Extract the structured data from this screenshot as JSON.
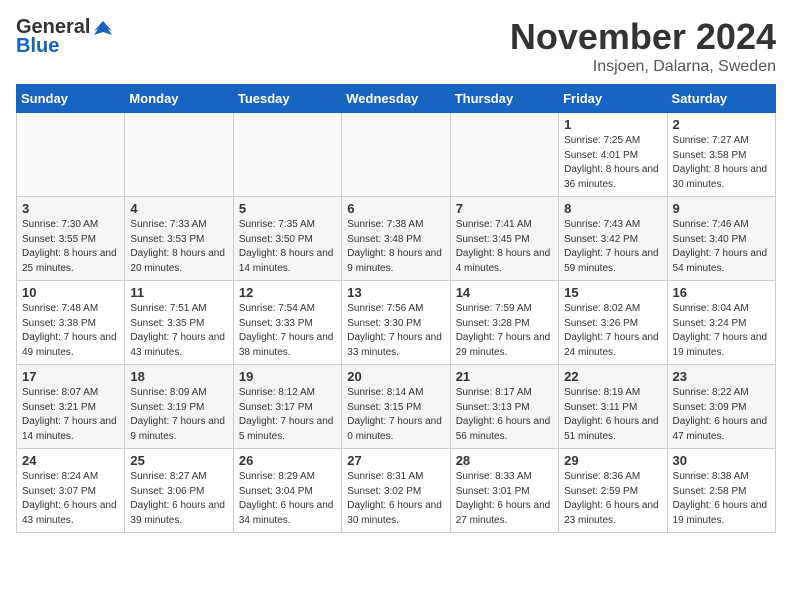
{
  "logo": {
    "general": "General",
    "blue": "Blue"
  },
  "title": "November 2024",
  "subtitle": "Insjoen, Dalarna, Sweden",
  "days_of_week": [
    "Sunday",
    "Monday",
    "Tuesday",
    "Wednesday",
    "Thursday",
    "Friday",
    "Saturday"
  ],
  "weeks": [
    {
      "shaded": false,
      "days": [
        {
          "date": "",
          "info": ""
        },
        {
          "date": "",
          "info": ""
        },
        {
          "date": "",
          "info": ""
        },
        {
          "date": "",
          "info": ""
        },
        {
          "date": "",
          "info": ""
        },
        {
          "date": "1",
          "info": "Sunrise: 7:25 AM\nSunset: 4:01 PM\nDaylight: 8 hours and 36 minutes."
        },
        {
          "date": "2",
          "info": "Sunrise: 7:27 AM\nSunset: 3:58 PM\nDaylight: 8 hours and 30 minutes."
        }
      ]
    },
    {
      "shaded": true,
      "days": [
        {
          "date": "3",
          "info": "Sunrise: 7:30 AM\nSunset: 3:55 PM\nDaylight: 8 hours and 25 minutes."
        },
        {
          "date": "4",
          "info": "Sunrise: 7:33 AM\nSunset: 3:53 PM\nDaylight: 8 hours and 20 minutes."
        },
        {
          "date": "5",
          "info": "Sunrise: 7:35 AM\nSunset: 3:50 PM\nDaylight: 8 hours and 14 minutes."
        },
        {
          "date": "6",
          "info": "Sunrise: 7:38 AM\nSunset: 3:48 PM\nDaylight: 8 hours and 9 minutes."
        },
        {
          "date": "7",
          "info": "Sunrise: 7:41 AM\nSunset: 3:45 PM\nDaylight: 8 hours and 4 minutes."
        },
        {
          "date": "8",
          "info": "Sunrise: 7:43 AM\nSunset: 3:42 PM\nDaylight: 7 hours and 59 minutes."
        },
        {
          "date": "9",
          "info": "Sunrise: 7:46 AM\nSunset: 3:40 PM\nDaylight: 7 hours and 54 minutes."
        }
      ]
    },
    {
      "shaded": false,
      "days": [
        {
          "date": "10",
          "info": "Sunrise: 7:48 AM\nSunset: 3:38 PM\nDaylight: 7 hours and 49 minutes."
        },
        {
          "date": "11",
          "info": "Sunrise: 7:51 AM\nSunset: 3:35 PM\nDaylight: 7 hours and 43 minutes."
        },
        {
          "date": "12",
          "info": "Sunrise: 7:54 AM\nSunset: 3:33 PM\nDaylight: 7 hours and 38 minutes."
        },
        {
          "date": "13",
          "info": "Sunrise: 7:56 AM\nSunset: 3:30 PM\nDaylight: 7 hours and 33 minutes."
        },
        {
          "date": "14",
          "info": "Sunrise: 7:59 AM\nSunset: 3:28 PM\nDaylight: 7 hours and 29 minutes."
        },
        {
          "date": "15",
          "info": "Sunrise: 8:02 AM\nSunset: 3:26 PM\nDaylight: 7 hours and 24 minutes."
        },
        {
          "date": "16",
          "info": "Sunrise: 8:04 AM\nSunset: 3:24 PM\nDaylight: 7 hours and 19 minutes."
        }
      ]
    },
    {
      "shaded": true,
      "days": [
        {
          "date": "17",
          "info": "Sunrise: 8:07 AM\nSunset: 3:21 PM\nDaylight: 7 hours and 14 minutes."
        },
        {
          "date": "18",
          "info": "Sunrise: 8:09 AM\nSunset: 3:19 PM\nDaylight: 7 hours and 9 minutes."
        },
        {
          "date": "19",
          "info": "Sunrise: 8:12 AM\nSunset: 3:17 PM\nDaylight: 7 hours and 5 minutes."
        },
        {
          "date": "20",
          "info": "Sunrise: 8:14 AM\nSunset: 3:15 PM\nDaylight: 7 hours and 0 minutes."
        },
        {
          "date": "21",
          "info": "Sunrise: 8:17 AM\nSunset: 3:13 PM\nDaylight: 6 hours and 56 minutes."
        },
        {
          "date": "22",
          "info": "Sunrise: 8:19 AM\nSunset: 3:11 PM\nDaylight: 6 hours and 51 minutes."
        },
        {
          "date": "23",
          "info": "Sunrise: 8:22 AM\nSunset: 3:09 PM\nDaylight: 6 hours and 47 minutes."
        }
      ]
    },
    {
      "shaded": false,
      "days": [
        {
          "date": "24",
          "info": "Sunrise: 8:24 AM\nSunset: 3:07 PM\nDaylight: 6 hours and 43 minutes."
        },
        {
          "date": "25",
          "info": "Sunrise: 8:27 AM\nSunset: 3:06 PM\nDaylight: 6 hours and 39 minutes."
        },
        {
          "date": "26",
          "info": "Sunrise: 8:29 AM\nSunset: 3:04 PM\nDaylight: 6 hours and 34 minutes."
        },
        {
          "date": "27",
          "info": "Sunrise: 8:31 AM\nSunset: 3:02 PM\nDaylight: 6 hours and 30 minutes."
        },
        {
          "date": "28",
          "info": "Sunrise: 8:33 AM\nSunset: 3:01 PM\nDaylight: 6 hours and 27 minutes."
        },
        {
          "date": "29",
          "info": "Sunrise: 8:36 AM\nSunset: 2:59 PM\nDaylight: 6 hours and 23 minutes."
        },
        {
          "date": "30",
          "info": "Sunrise: 8:38 AM\nSunset: 2:58 PM\nDaylight: 6 hours and 19 minutes."
        }
      ]
    }
  ]
}
